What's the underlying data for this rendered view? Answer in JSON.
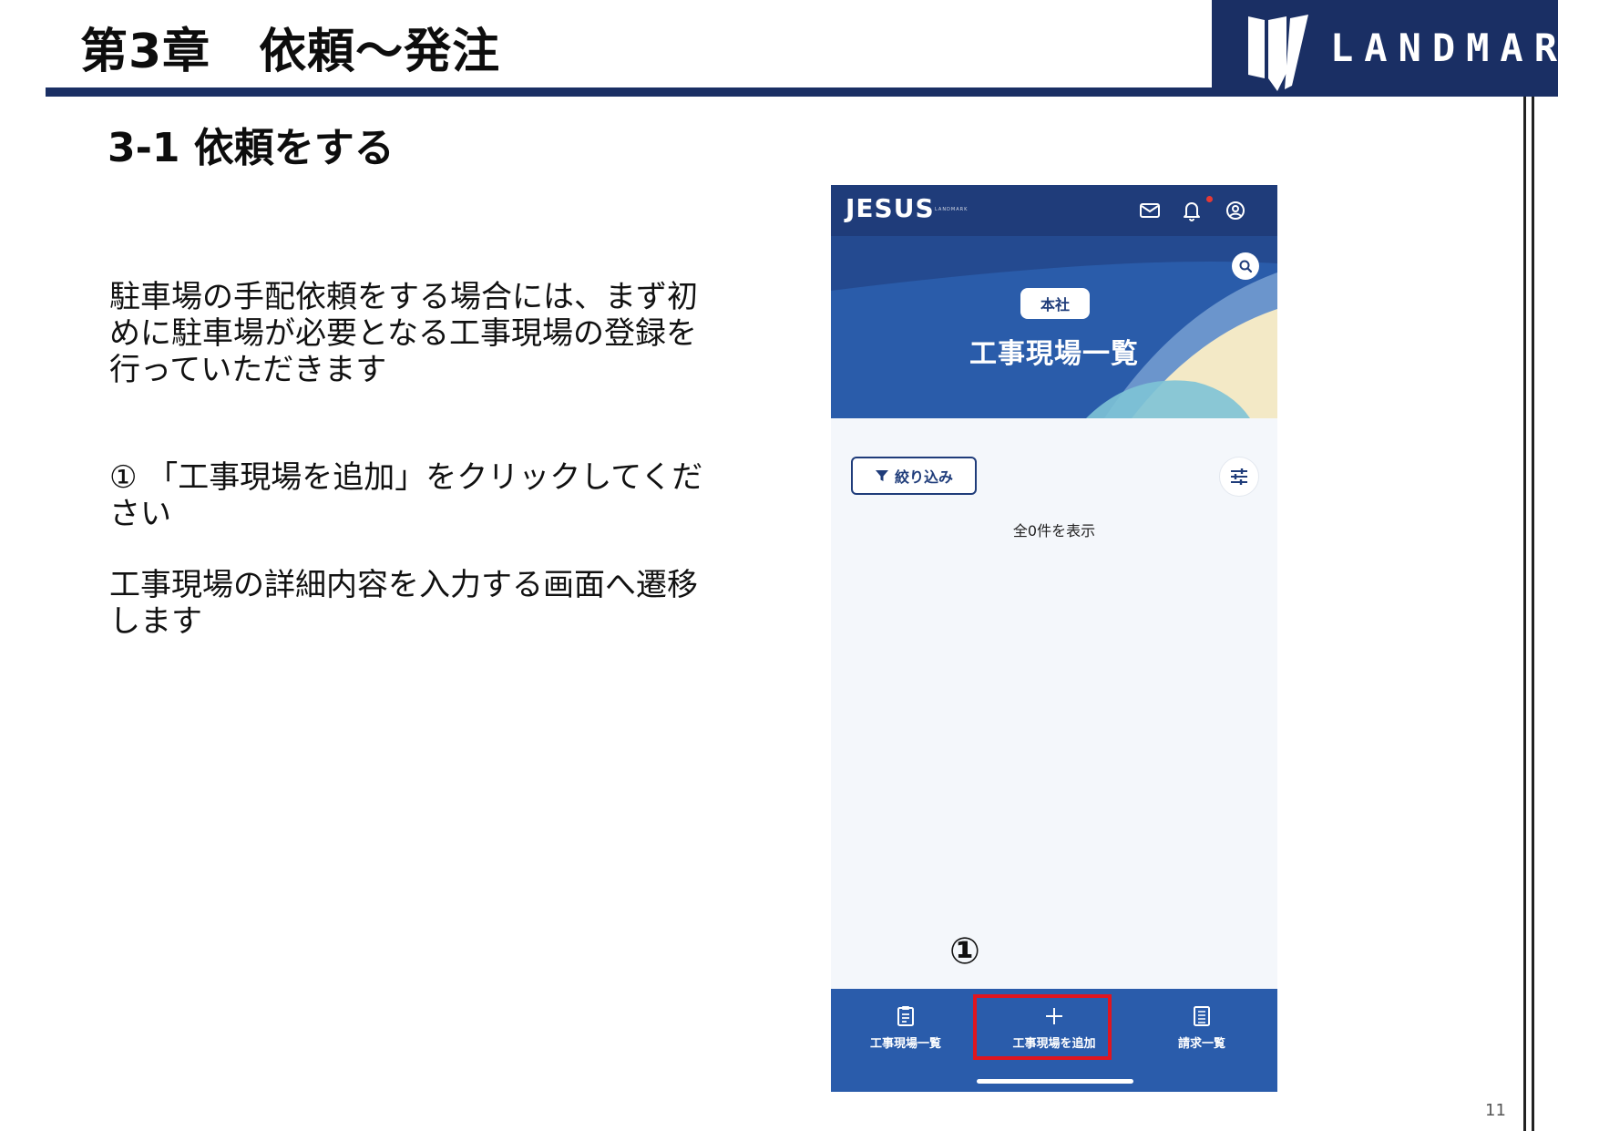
{
  "slide": {
    "chapter_title": "第3章　依頼～発注",
    "logo_text": "LANDMARK",
    "section_title": "3-1 依頼をする",
    "description_1": "駐車場の手配依頼をする場合には、まず初めに駐車場が必要となる工事現場の登録を行っていただきます",
    "description_2": "① 「工事現場を追加」をクリックしてください",
    "description_3": "工事現場の詳細内容を入力する画面へ遷移します",
    "page_number": "11"
  },
  "app": {
    "brand": "JESUS",
    "brand_sub": "LANDMARK",
    "branch_badge": "本社",
    "page_title": "工事現場一覧",
    "filter_label": "絞り込み",
    "result_count": "全0件を表示",
    "marker": "①",
    "bottom_nav": [
      {
        "label": "工事現場一覧",
        "icon": "clipboard-icon"
      },
      {
        "label": "工事現場を追加",
        "icon": "plus-icon"
      },
      {
        "label": "請求一覧",
        "icon": "document-list-icon"
      }
    ]
  },
  "colors": {
    "navy": "#1a2f64",
    "app_blue": "#1f3c7a",
    "nav_blue": "#2a5cab",
    "highlight_red": "#e0151f",
    "notification_red": "#e53935"
  }
}
